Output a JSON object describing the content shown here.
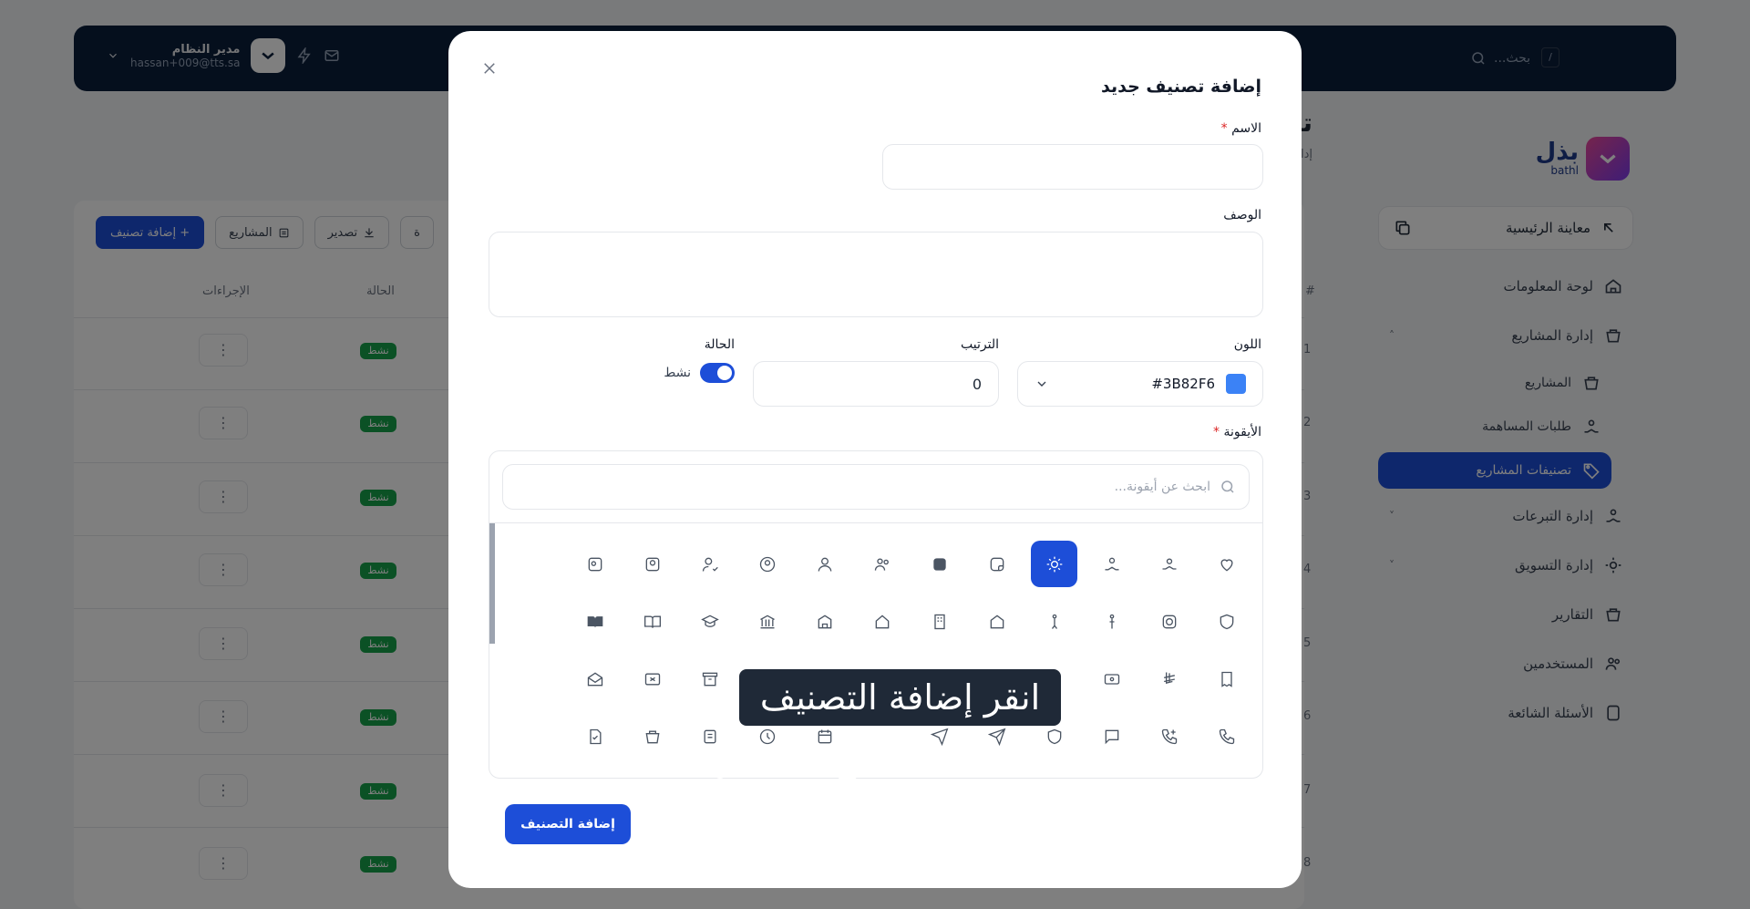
{
  "topbar": {
    "search_placeholder": "بحث...",
    "shortcut": "/",
    "user_name": "مدير النظام",
    "user_email": "hassan+009@tts.sa"
  },
  "sidebar": {
    "logo_text": "بذل",
    "logo_sub": "bathl",
    "preview_label": "معاينة الرئيسية",
    "items": [
      {
        "label": "لوحة المعلومات",
        "icon": "dashboard-icon"
      },
      {
        "label": "إدارة المشاريع",
        "icon": "projects-icon"
      },
      {
        "label": "المشاريع",
        "icon": "box-icon"
      },
      {
        "label": "طلبات المساهمة",
        "icon": "hand-heart-icon"
      },
      {
        "label": "تصنيفات المشاريع",
        "icon": "tag-icon"
      },
      {
        "label": "إدارة التبرعات",
        "icon": "donations-icon"
      },
      {
        "label": "إدارة التسويق",
        "icon": "marketing-icon"
      },
      {
        "label": "التقارير",
        "icon": "reports-icon"
      },
      {
        "label": "المستخدمين",
        "icon": "users-icon"
      },
      {
        "label": "الأسئلة الشائعة",
        "icon": "faq-icon"
      }
    ]
  },
  "page": {
    "title": "تص",
    "subtitle": "إدارة ت",
    "add_button": "+ إضافة تصنيف",
    "projects_button": "المشاريع",
    "export_button": "تصدير",
    "partial_button": "ة",
    "col_actions": "الإجراءات",
    "col_status": "الحالة",
    "col_num": "#",
    "status_active": "نشط",
    "row_numbers": [
      "1",
      "2",
      "3",
      "4",
      "5",
      "6",
      "7",
      "8"
    ]
  },
  "modal": {
    "title": "إضافة تصنيف جديد",
    "name_label": "الاسم",
    "name_value": "",
    "description_label": "الوصف",
    "description_value": "",
    "color_label": "اللون",
    "color_value": "#3B82F6",
    "color_hex": "#3b82f6",
    "order_label": "الترتيب",
    "order_value": "0",
    "status_label": "الحالة",
    "status_value": "نشط",
    "icon_label": "الأيقونة",
    "icon_search_placeholder": "ابحث عن أيقونة...",
    "submit_label": "إضافة التصنيف",
    "required_mark": "*"
  },
  "tooltip": {
    "text": "انقر إضافة التصنيف"
  }
}
